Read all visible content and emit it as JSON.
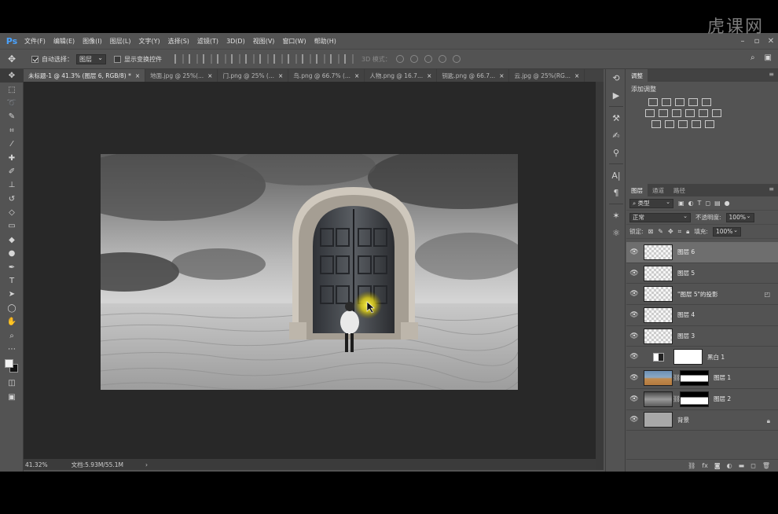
{
  "app": {
    "logo": "Ps",
    "watermark": "虎课网"
  },
  "menu": [
    "文件(F)",
    "编辑(E)",
    "图像(I)",
    "图层(L)",
    "文字(Y)",
    "选择(S)",
    "滤镜(T)",
    "3D(D)",
    "视图(V)",
    "窗口(W)",
    "帮助(H)"
  ],
  "options": {
    "auto_select_label": "自动选择：",
    "auto_select_target": "图层",
    "show_transform_label": "显示变换控件",
    "mode_3d_label": "3D 模式："
  },
  "tabs": [
    {
      "label": "未标题-1 @ 41.3% (图层 6, RGB/8) *",
      "active": true
    },
    {
      "label": "地面.jpg @ 25%(...",
      "active": false
    },
    {
      "label": "门.png @ 25% (...",
      "active": false
    },
    {
      "label": "鸟.png @ 66.7% (...",
      "active": false
    },
    {
      "label": "人物.png @ 16.7...",
      "active": false
    },
    {
      "label": "钥匙.png @ 66.7...",
      "active": false
    },
    {
      "label": "云.jpg @ 25%(RG...",
      "active": false
    }
  ],
  "status": {
    "zoom": "41.32%",
    "doc": "文档:5.93M/55.1M"
  },
  "adjustments": {
    "tab": "调整",
    "title": "添加调整"
  },
  "layers_panel": {
    "tabs": [
      "图层",
      "通道",
      "路径"
    ],
    "filter_kind": "类型",
    "blend_mode": "正常",
    "opacity_label": "不透明度:",
    "opacity_value": "100%",
    "lock_label": "锁定:",
    "fill_label": "填充:",
    "fill_value": "100%",
    "layers": [
      {
        "name": "图层 6",
        "selected": true
      },
      {
        "name": "图层 5",
        "selected": false
      },
      {
        "name": "\"图层 5\"的投影",
        "selected": false
      },
      {
        "name": "图层 4",
        "selected": false
      },
      {
        "name": "图层 3",
        "selected": false
      },
      {
        "name": "黑白 1",
        "selected": false
      },
      {
        "name": "图层 1",
        "selected": false
      },
      {
        "name": "图层 2",
        "selected": false
      },
      {
        "name": "背景",
        "selected": false
      }
    ]
  }
}
